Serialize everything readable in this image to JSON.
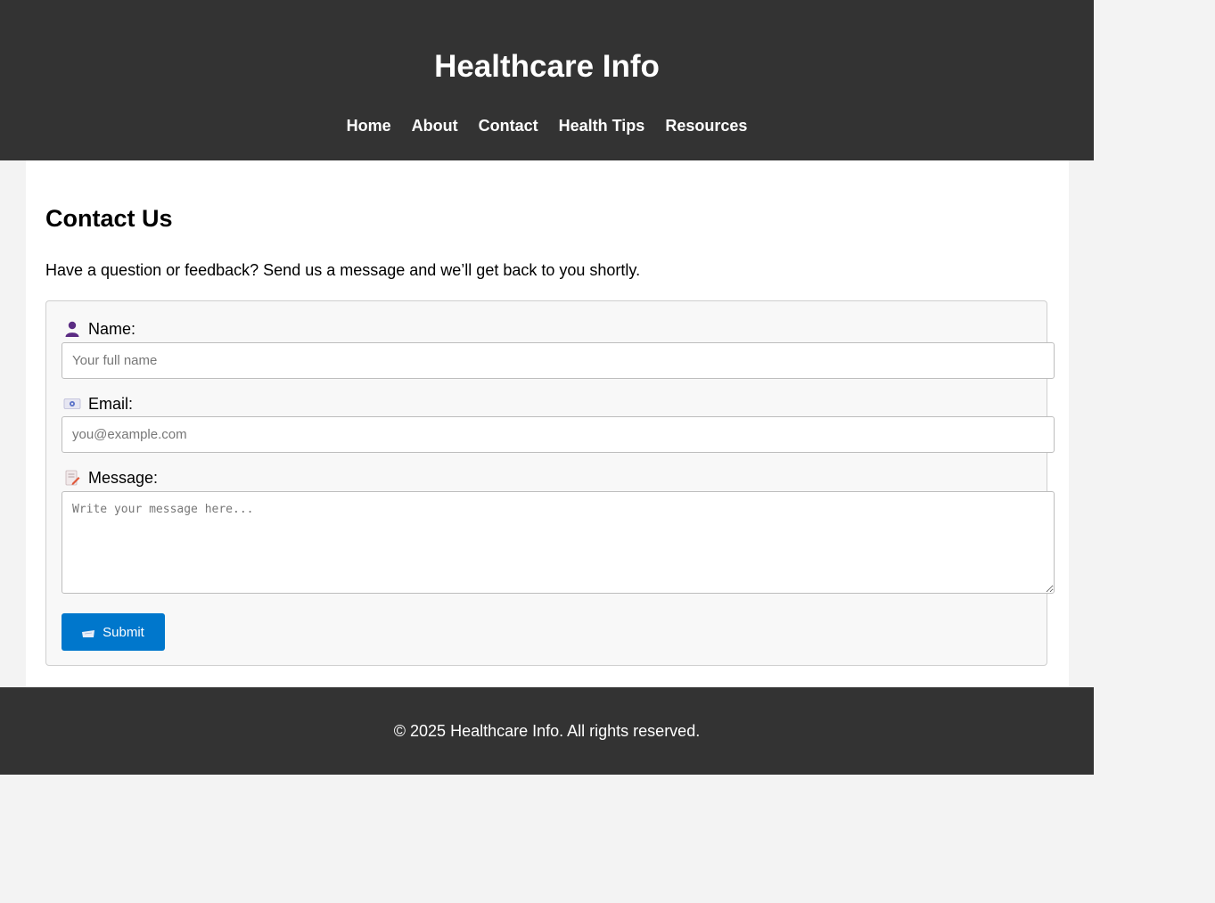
{
  "header": {
    "title": "Healthcare Info",
    "nav": [
      {
        "label": "Home"
      },
      {
        "label": "About"
      },
      {
        "label": "Contact"
      },
      {
        "label": "Health Tips"
      },
      {
        "label": "Resources"
      }
    ]
  },
  "main": {
    "heading": "Contact Us",
    "intro": "Have a question or feedback? Send us a message and we’ll get back to you shortly.",
    "form": {
      "name": {
        "label": "Name:",
        "icon": "person-icon",
        "placeholder": "Your full name",
        "value": ""
      },
      "email": {
        "label": "Email:",
        "icon": "envelope-icon",
        "placeholder": "you@example.com",
        "value": ""
      },
      "message": {
        "label": "Message:",
        "icon": "memo-icon",
        "placeholder": "Write your message here...",
        "value": ""
      },
      "submit": {
        "label": "Submit",
        "icon": "send-icon"
      }
    }
  },
  "footer": {
    "text": "© 2025 Healthcare Info. All rights reserved."
  },
  "colors": {
    "header_bg": "#333333",
    "button_bg": "#0077cc",
    "page_bg": "#f3f3f3",
    "form_bg": "#f8f8f8"
  }
}
